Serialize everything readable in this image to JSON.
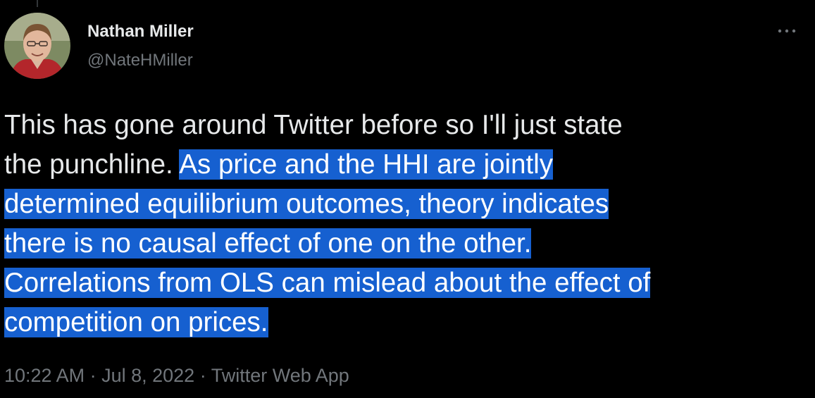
{
  "author": {
    "name": "Nathan Miller",
    "handle": "@NateHMiller"
  },
  "tweet": {
    "lines": [
      "This has gone around Twitter before so I'll just state",
      "the punchline. ",
      "As price and the HHI are jointly ",
      "determined equilibrium outcomes, theory indicates ",
      "there is no causal effect of one on the other. ",
      "Correlations from OLS can mislead about the effect of ",
      "competition on prices."
    ]
  },
  "meta": {
    "time": "10:22 AM",
    "sep1": " · ",
    "date": "Jul 8, 2022",
    "sep2": " · ",
    "source": "Twitter Web App"
  },
  "icons": {
    "more": "more-options-icon",
    "avatar": "avatar"
  },
  "colors": {
    "background": "#000000",
    "text": "#e7e9ea",
    "muted": "#71767b",
    "selection": "#1660d0"
  }
}
